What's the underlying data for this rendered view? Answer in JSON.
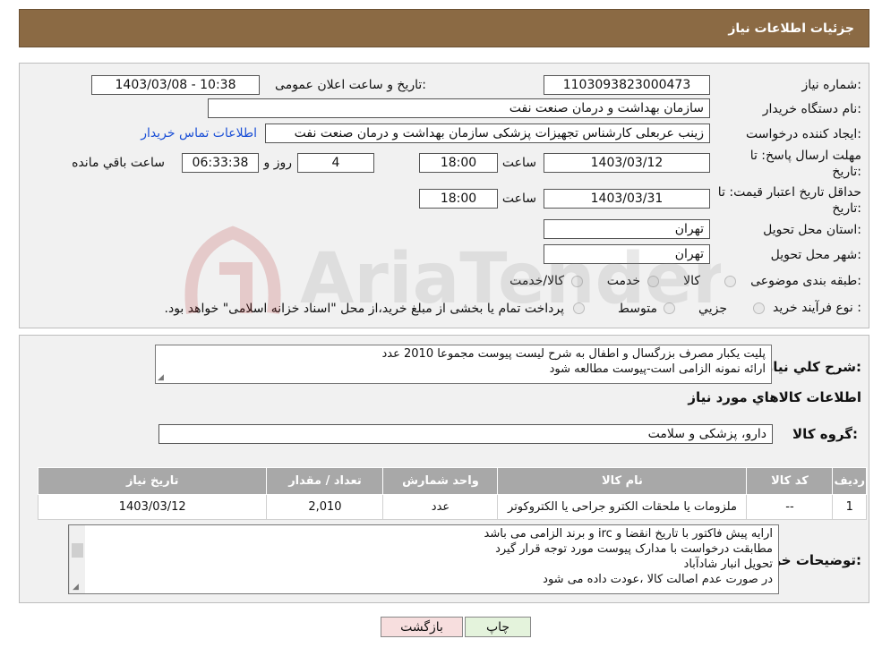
{
  "header": {
    "title": "جزئیات اطلاعات نیاز"
  },
  "form": {
    "need_number_label": "شماره نیاز:",
    "need_number": "1103093823000473",
    "announce_label": "تاریخ و ساعت اعلان عمومی:",
    "announce_value": "1403/03/08 - 10:38",
    "buyer_org_label": "نام دستگاه خریدار:",
    "buyer_org": "سازمان بهداشت و درمان صنعت نفت",
    "requester_label": "ایجاد کننده درخواست:",
    "requester": "زینب عربعلی کارشناس تجهیزات پزشکی سازمان بهداشت و درمان صنعت نفت",
    "contact_link": "اطلاعات تماس خریدار",
    "deadline_label_1": "مهلت ارسال پاسخ: تا",
    "deadline_label_2": "تاریخ:",
    "deadline_date": "1403/03/12",
    "time_label": "ساعت",
    "deadline_time": "18:00",
    "days_value": "4",
    "days_label": "روز و",
    "remaining_time": "06:33:38",
    "remaining_label": "ساعت باقي مانده",
    "validity_label_1": "حداقل تاریخ اعتبار قیمت: تا",
    "validity_label_2": "تاریخ:",
    "validity_date": "1403/03/31",
    "validity_time": "18:00",
    "province_label": "استان محل تحویل:",
    "province": "تهران",
    "city_label": "شهر محل تحویل:",
    "city": "تهران",
    "category_label": "طبقه بندی موضوعی:",
    "category_options": [
      "کالا",
      "خدمت",
      "کالا/خدمت"
    ],
    "process_label": "نوع فرآیند خرید :",
    "process_options": [
      "جزیي",
      "متوسط"
    ],
    "process_note": "پرداخت تمام یا بخشی از مبلغ خرید،از محل \"اسناد خزانه اسلامی\" خواهد بود."
  },
  "description": {
    "label": "شرح کلي نياز:",
    "line1": "پلیت یکبار مصرف بزرگسال و اطفال به شرح لیست پیوست مجموعا 2010 عدد",
    "line2": "ارائه نمونه الزامی است-پیوست مطالعه شود"
  },
  "goods": {
    "section_title": "اطلاعات کالاهاي مورد نياز",
    "group_label": "گروه کالا:",
    "group_value": "دارو، پزشکی و سلامت",
    "columns": [
      "رديف",
      "کد کالا",
      "نام کالا",
      "واحد شمارش",
      "تعداد / مقدار",
      "تاریخ نیاز"
    ],
    "rows": [
      [
        "1",
        "--",
        "ملزومات یا ملحقات الکترو جراحی یا الکتروکوتر",
        "عدد",
        "2,010",
        "1403/03/12"
      ]
    ]
  },
  "buyer_notes": {
    "label": "توضیحات خریدار:",
    "line1": "ارایه  پیش فاکتور با تاریخ انقضا و irc  و برند الزامی می باشد",
    "line2": "مطابقت درخواست با مدارک پیوست مورد توجه قرار گیرد",
    "line3": "تحویل انبار شادآباد",
    "line4": "در صورت عدم اصالت کالا ،عودت داده می شود"
  },
  "buttons": {
    "print": "چاپ",
    "back": "بازگشت"
  },
  "watermark": {
    "text": "AriaTender.neT"
  },
  "colors": {
    "header_bg": "#8b6a44",
    "link": "#1a4fd6",
    "back_button_bg": "#f7dede",
    "print_button_bg": "#e4f3dc"
  }
}
